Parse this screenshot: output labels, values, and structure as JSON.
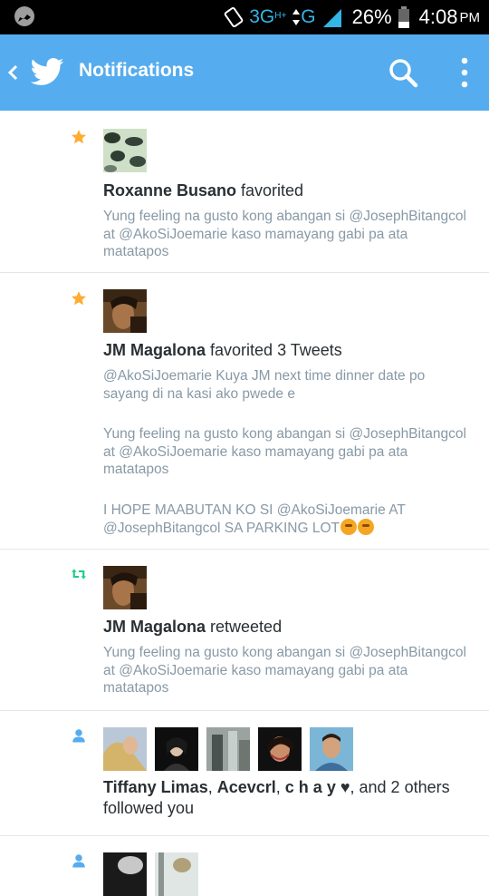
{
  "status_bar": {
    "network_label": "3G",
    "network_sup": "H+",
    "network_label2": "G",
    "battery": "26%",
    "time": "4:08",
    "ampm": "PM"
  },
  "app_bar": {
    "title": "Notifications"
  },
  "notifications": [
    {
      "type": "favorite",
      "actor": "Roxanne Busano",
      "action": " favorited",
      "tweets": [
        "Yung feeling na gusto kong abangan si @JosephBitangcol at @AkoSiJoemarie kaso mamayang gabi pa ata matatapos"
      ]
    },
    {
      "type": "favorite",
      "actor": "JM Magalona",
      "action": " favorited 3 Tweets",
      "tweets": [
        "@AkoSiJoemarie Kuya JM next time dinner date po sayang di na kasi ako pwede e",
        "Yung feeling na gusto kong abangan si @JosephBitangcol at @AkoSiJoemarie kaso mamayang gabi pa ata matatapos",
        "I HOPE MAABUTAN KO SI @AkoSiJoemarie AT @JosephBitangcol  SA PARKING LOT"
      ]
    },
    {
      "type": "retweet",
      "actor": "JM Magalona",
      "action": " retweeted",
      "tweets": [
        "Yung feeling na gusto kong abangan si @JosephBitangcol at @AkoSiJoemarie kaso mamayang gabi pa ata matatapos"
      ]
    },
    {
      "type": "follow",
      "actor": "Tiffany Limas",
      "sep1": ", ",
      "actor2": "Acevcrl",
      "sep2": ", ",
      "actor3": "c h a y ♥",
      "action": ", and 2 others followed you"
    }
  ],
  "colors": {
    "app_bar": "#55acee",
    "favorite_star": "#ffac33",
    "retweet": "#19cf86",
    "follow": "#55acee",
    "tweet_text": "#8899a6"
  },
  "icons": {
    "favorite": "star-icon",
    "retweet": "retweet-icon",
    "follow": "person-icon",
    "search": "search-icon",
    "overflow": "overflow-menu-icon"
  }
}
